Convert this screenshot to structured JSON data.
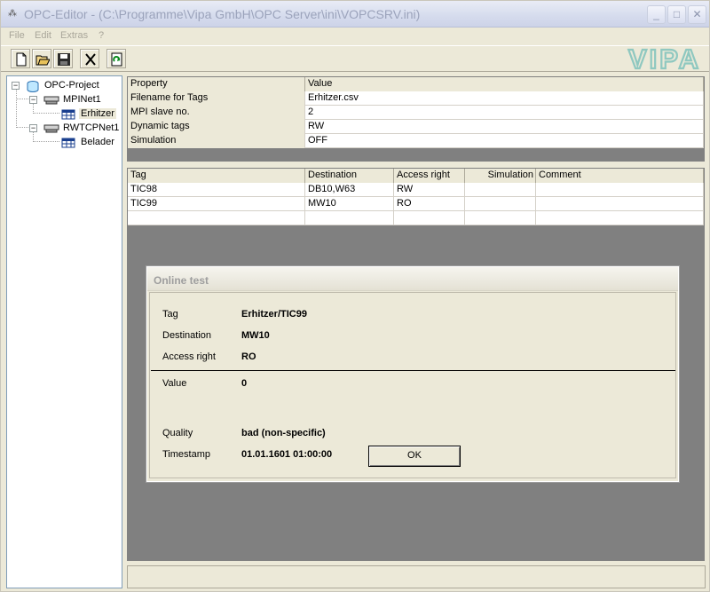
{
  "window": {
    "title": "OPC-Editor - (C:\\Programme\\Vipa GmbH\\OPC Server\\ini\\VOPCSRV.ini)",
    "minimize": "_",
    "maximize": "□",
    "close": "✕"
  },
  "menu": [
    "File",
    "Edit",
    "Extras",
    "?"
  ],
  "toolbar": {
    "icons": [
      "new-file-icon",
      "open-folder-icon",
      "save-icon",
      "delete-icon",
      "refresh-icon"
    ]
  },
  "brand": {
    "logo": "VIPA",
    "color": "#8fc8c0"
  },
  "tree": {
    "root": "OPC-Project",
    "nodes": [
      {
        "label": "MPINet1",
        "children": [
          "Erhitzer"
        ]
      },
      {
        "label": "RWTCPNet1",
        "children": [
          "Belader"
        ]
      }
    ]
  },
  "properties": {
    "headers": [
      "Property",
      "Value"
    ],
    "rows": [
      [
        "Filename for Tags",
        "Erhitzer.csv"
      ],
      [
        "MPI slave no.",
        "2"
      ],
      [
        "Dynamic tags",
        "RW"
      ],
      [
        "Simulation",
        "OFF"
      ]
    ]
  },
  "tags": {
    "headers": [
      "Tag",
      "Destination",
      "Access right",
      "Simulation",
      "Comment"
    ],
    "rows": [
      [
        "TIC98",
        "DB10,W63",
        "RW",
        "",
        ""
      ],
      [
        "TIC99",
        "MW10",
        "RO",
        "",
        ""
      ]
    ]
  },
  "dialog": {
    "title": "Online test",
    "fields": {
      "tag_label": "Tag",
      "tag_value": "Erhitzer/TIC99",
      "dest_label": "Destination",
      "dest_value": "MW10",
      "access_label": "Access right",
      "access_value": "RO",
      "value_label": "Value",
      "value_value": "0",
      "quality_label": "Quality",
      "quality_value": "bad (non-specific)",
      "timestamp_label": "Timestamp",
      "timestamp_value": "01.01.1601 01:00:00"
    },
    "ok_label": "OK"
  }
}
